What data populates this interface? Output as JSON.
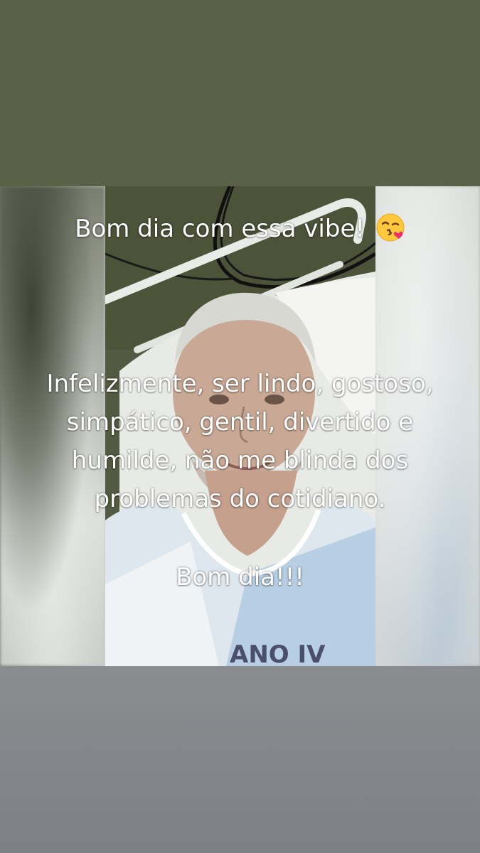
{
  "post": {
    "title_line": "Bom dia com essa vibe!",
    "title_emoji": "kissing-face-with-heart-emoji",
    "body_lines": [
      "Infelizmente, ser lindo, gostoso,",
      "simpático, gentil, divertido e",
      "humilde, não me blinda dos",
      "problemas do cotidiano."
    ],
    "sign_off": "Bom dia!!!",
    "shirt_print": "ANO IV"
  },
  "colors": {
    "top_band": "#5b6147",
    "bottom_band": "#84868b",
    "caption_text": "#ffffff",
    "emoji_face": "#ffc83d",
    "emoji_heart": "#e8336b"
  }
}
